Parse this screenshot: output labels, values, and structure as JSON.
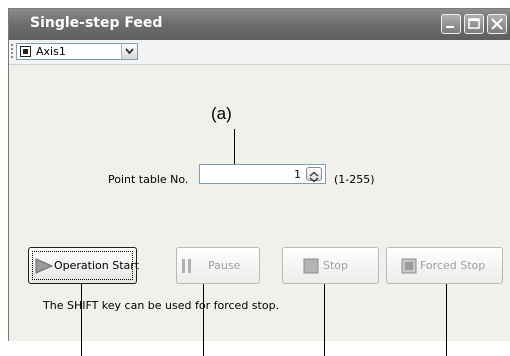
{
  "window": {
    "title": "Single-step Feed"
  },
  "titlebar_buttons": [
    "minimize",
    "maximize",
    "close"
  ],
  "toolbar": {
    "axis_selector": {
      "selected": "Axis1"
    }
  },
  "annotation": {
    "caption": "(a)"
  },
  "point_table": {
    "label": "Point table No.",
    "value": "1",
    "range": "(1-255)"
  },
  "buttons": {
    "operation_start": {
      "label": "Operation Start",
      "enabled": true
    },
    "pause": {
      "label": "Pause",
      "enabled": false
    },
    "stop": {
      "label": "Stop",
      "enabled": false
    },
    "forced_stop": {
      "label": "Forced Stop",
      "enabled": false
    }
  },
  "status": {
    "message": "The SHIFT key can be used for forced stop."
  },
  "colors": {
    "title_bar": "#6f6f6f",
    "window_bg": "#ece9d8",
    "disabled_text": "#a0a0a0"
  }
}
